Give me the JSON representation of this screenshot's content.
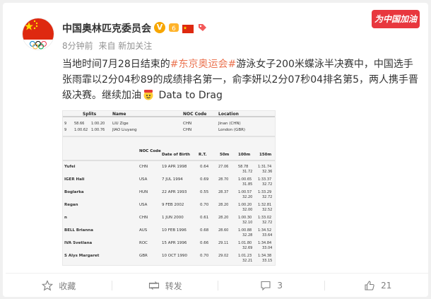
{
  "account": {
    "name": "中国奥林匹克委员会",
    "verified_badge": "V",
    "icons": [
      "level-icon",
      "china-flag-icon",
      "tag-icon"
    ],
    "banner": "为中国加油"
  },
  "meta": {
    "time": "8分钟前",
    "source": "来自 新加关注"
  },
  "post": {
    "text_prefix": "当地时间7月28日结束的",
    "topic": "#东京奥运会#",
    "text_main": "游泳女子200米蝶泳半决赛中，中国选手张雨霏以2分04秒89的成绩排名第一，俞李妍以2分07秒04排名第5，两人携手晋级决赛。继续加油",
    "text_suffix": " Data to Drag"
  },
  "image": {
    "header": {
      "splits": "Splits",
      "name": "Name",
      "noc": "NOC Code",
      "location": "Location"
    },
    "top_rows": [
      {
        "c1": "9",
        "c2": "58.66",
        "c3": "1:00.20",
        "name": "LIU Zige",
        "noc": "CHN",
        "loc": "Jinan (CHN)"
      },
      {
        "c1": "9",
        "c2": "1:00.62",
        "c3": "1:00.76",
        "name": "JIAO Liuyang",
        "noc": "CHN",
        "loc": "London (GBR)"
      }
    ],
    "cols": {
      "noc": "NOC Code",
      "dob": "Date of Birth",
      "rt": "R.T.",
      "m50": "50m",
      "m100": "100m",
      "m150": "150m"
    },
    "rows": [
      {
        "name": "Yufei",
        "noc": "CHN",
        "dob": "19 APR 1998",
        "rt": "0.64",
        "m50": "27.06",
        "m100": "58.78",
        "m100b": "31.72",
        "m150": "1:31.74",
        "m150b": "32.36"
      },
      {
        "name": "IGER Hali",
        "noc": "USA",
        "dob": "7 JUL 1994",
        "rt": "0.69",
        "m50": "28.70",
        "m100": "1:00.65",
        "m100b": "31.85",
        "m150": "1:33.37",
        "m150b": "32.72"
      },
      {
        "name": "Boglarka",
        "noc": "HUN",
        "dob": "22 APR 1993",
        "rt": "0.55",
        "m50": "28.37",
        "m100": "1:00.57",
        "m100b": "32.20",
        "m150": "1:33.29",
        "m150b": "32.72"
      },
      {
        "name": "Regan",
        "noc": "USA",
        "dob": "9 FEB 2002",
        "rt": "0.70",
        "m50": "28.20",
        "m100": "1:00.20",
        "m100b": "32.00",
        "m150": "1:32.81",
        "m150b": "32.52"
      },
      {
        "name": "n",
        "noc": "CHN",
        "dob": "1 JUN 2000",
        "rt": "0.61",
        "m50": "28.20",
        "m100": "1:00.30",
        "m100b": "32.10",
        "m150": "1:33.02",
        "m150b": "32.72"
      },
      {
        "name": "BELL Brianna",
        "noc": "AUS",
        "dob": "10 FEB 1996",
        "rt": "0.68",
        "m50": "28.60",
        "m100": "1:00.88",
        "m100b": "32.28",
        "m150": "1:34.52",
        "m150b": "33.64"
      },
      {
        "name": "IVA Svetlana",
        "noc": "ROC",
        "dob": "15 APR 1996",
        "rt": "0.66",
        "m50": "29.11",
        "m100": "1:01.80",
        "m100b": "32.69",
        "m150": "1:34.84",
        "m150b": "33.04"
      },
      {
        "name": "S Alys Margaret",
        "noc": "GBR",
        "dob": "10 OCT 1990",
        "rt": "0.70",
        "m50": "29.02",
        "m100": "1:01.23",
        "m100b": "32.21",
        "m150": "1:34.38",
        "m150b": "33.15"
      }
    ]
  },
  "actions": {
    "favorite": "收藏",
    "repost": "转发",
    "comment_count": "3",
    "like_count": "21"
  }
}
